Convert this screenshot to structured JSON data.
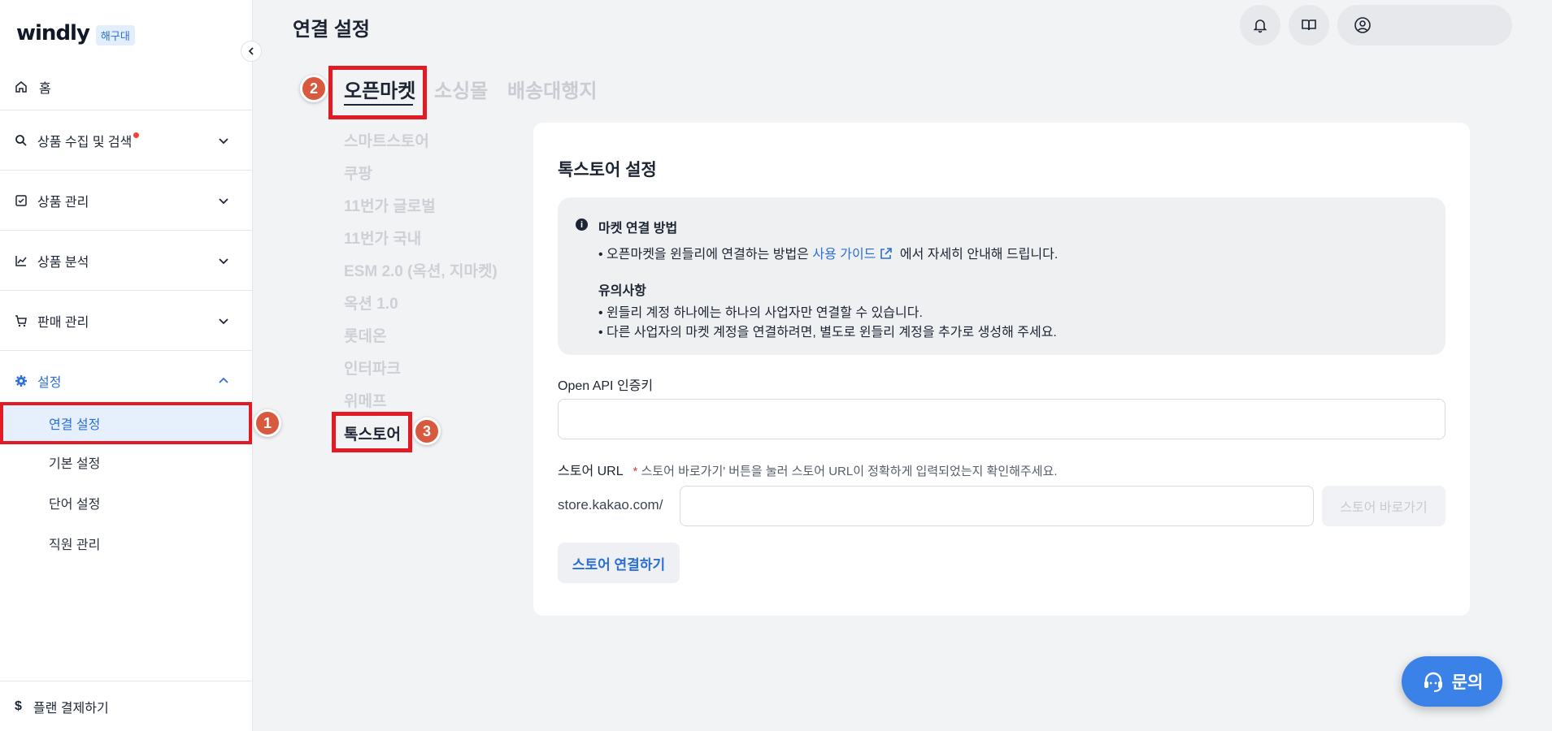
{
  "brand": {
    "logo": "windly",
    "badge": "해구대"
  },
  "sidebar": {
    "home": "홈",
    "groups": [
      {
        "label": "상품 수집 및 검색",
        "has_dot": true
      },
      {
        "label": "상품 관리"
      },
      {
        "label": "상품 분석"
      },
      {
        "label": "판매 관리"
      },
      {
        "label": "설정"
      }
    ],
    "settings_items": [
      "연결 설정",
      "기본 설정",
      "단어 설정",
      "직원 관리"
    ],
    "plan": "플랜 결제하기"
  },
  "header": {
    "title": "연결 설정"
  },
  "tabs": [
    "오픈마켓",
    "소싱몰",
    "배송대행지"
  ],
  "markets": [
    "스마트스토어",
    "쿠팡",
    "11번가 글로벌",
    "11번가 국내",
    "ESM 2.0 (옥션, 지마켓)",
    "옥션 1.0",
    "롯데온",
    "인터파크",
    "위메프",
    "톡스토어"
  ],
  "annotations": [
    "1",
    "2",
    "3"
  ],
  "card": {
    "title": "톡스토어 설정",
    "info": {
      "heading": "마켓 연결 방법",
      "line1_pre": "• 오픈마켓을 윈들리에 연결하는 방법은",
      "line1_link": "사용 가이드",
      "line1_post": "에서 자세히 안내해 드립니다.",
      "notice_heading": "유의사항",
      "notice1": "• 윈들리 계정 하나에는 하나의 사업자만 연결할 수 있습니다.",
      "notice2": "• 다른 사업자의 마켓 계정을 연결하려면, 별도로 윈들리 계정을 추가로 생성해 주세요."
    },
    "api_label": "Open API 인증키",
    "api_value": "",
    "url_label": "스토어 URL",
    "url_hint_star": "*",
    "url_hint": "스토어 바로가기' 버튼을 눌러 스토어 URL이 정확하게 입력되었는지 확인해주세요.",
    "url_prefix": "store.kakao.com/",
    "url_value": "",
    "goto_button": "스토어 바로가기",
    "connect_button": "스토어 연결하기"
  },
  "contact": "문의",
  "colors": {
    "accent": "#2b6fd6",
    "highlight": "#e01b24",
    "marker": "#d9593f",
    "contact": "#3b82e8"
  }
}
